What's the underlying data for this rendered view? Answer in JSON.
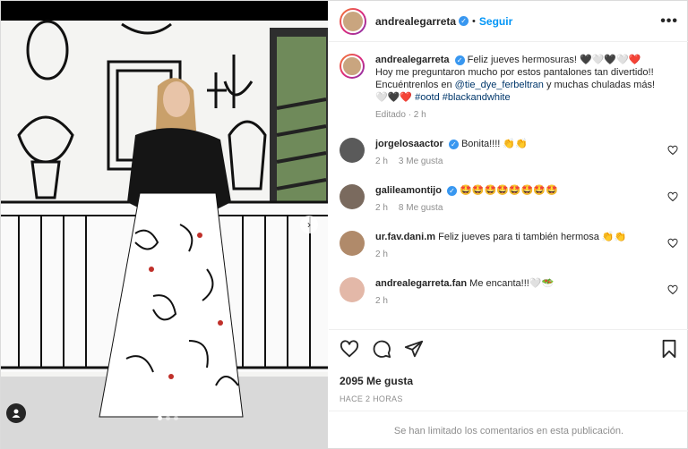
{
  "post": {
    "username": "andrealegarreta",
    "follow_label": "Seguir",
    "more_label": "•••"
  },
  "caption": {
    "username": "andrealegarreta",
    "text_1": "Feliz jueves hermosuras! 🖤🤍🖤🤍❤️",
    "text_2": "Hoy me preguntaron mucho por estos pantalones tan divertido!! Encuéntrenlos en ",
    "mention": "@tie_dye_ferbeltran",
    "text_3": " y muchas chuladas más! 🤍🖤❤️ ",
    "hashtag_1": "#ootd",
    "hashtag_2": "#blackandwhite",
    "meta": "Editado · 2 h"
  },
  "comments": [
    {
      "username": "jorgelosaactor",
      "text": "Bonita!!!! 👏👏",
      "time": "2 h",
      "likes": "3 Me gusta",
      "verified": true
    },
    {
      "username": "galileamontijo",
      "text": "🤩🤩🤩🤩🤩🤩🤩🤩",
      "time": "2 h",
      "likes": "8 Me gusta",
      "verified": true
    },
    {
      "username": "ur.fav.dani.m",
      "text": "Feliz jueves para ti también hermosa 👏👏",
      "time": "2 h",
      "likes": "",
      "verified": false
    },
    {
      "username": "andrealegarreta.fan",
      "text": "Me encanta!!!🤍🥗",
      "time": "2 h",
      "likes": "",
      "verified": false
    }
  ],
  "likes_count": "2095 Me gusta",
  "time_ago": "HACE 2 HORAS",
  "comments_limited": "Se han limitado los comentarios en esta publicación.",
  "colors": {
    "accent": "#0095f6",
    "verified": "#3897f0",
    "muted": "#8e8e8e",
    "link": "#00376b"
  }
}
